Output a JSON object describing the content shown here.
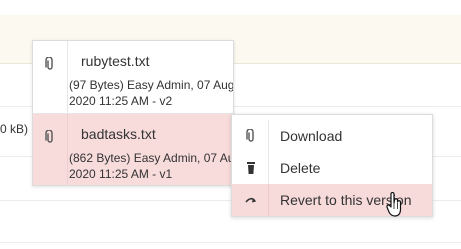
{
  "background": {
    "size_fragment": "0 kB)"
  },
  "versions_popup": {
    "items": [
      {
        "filename": "rubytest.txt",
        "meta": "(97 Bytes) Easy Admin, 07 Aug 2020 11:25 AM - v2",
        "icon": "paperclip-icon",
        "highlighted": false
      },
      {
        "filename": "badtasks.txt",
        "meta": "(862 Bytes) Easy Admin, 07 Aug 2020 11:25 AM - v1",
        "icon": "paperclip-icon",
        "highlighted": true
      }
    ]
  },
  "context_menu": {
    "items": [
      {
        "label": "Download",
        "icon": "paperclip-icon"
      },
      {
        "label": "Delete",
        "icon": "trash-icon"
      },
      {
        "label": "Revert to this version",
        "icon": "revert-arrow-icon",
        "hovered": true
      }
    ]
  },
  "colors": {
    "highlight": "#f8dcdc",
    "header_band": "#fcfaf0"
  }
}
